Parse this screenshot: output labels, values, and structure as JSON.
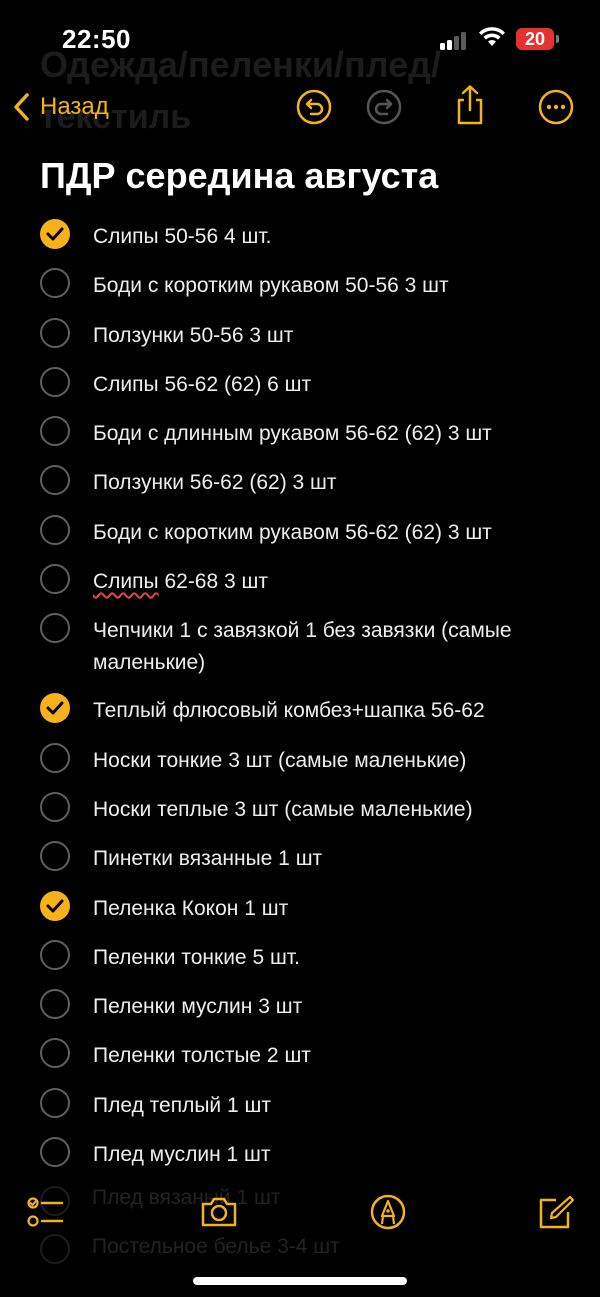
{
  "status_bar": {
    "time": "22:50",
    "battery_level": "20"
  },
  "background_ghost": {
    "line0": "",
    "line1": "Одежда/пеленки/плед/",
    "line2": "текстиль"
  },
  "nav": {
    "back_label": "Назад"
  },
  "note": {
    "title": "ПДР середина августа"
  },
  "checklist": [
    {
      "text": "Слипы 50-56 4 шт.",
      "checked": true
    },
    {
      "text": "Боди с коротким рукавом 50-56 3 шт",
      "checked": false
    },
    {
      "text": "Ползунки 50-56 3 шт",
      "checked": false
    },
    {
      "text": "Слипы 56-62 (62) 6 шт",
      "checked": false
    },
    {
      "text": "Боди с длинным рукавом 56-62 (62) 3 шт",
      "checked": false
    },
    {
      "text": "Ползунки 56-62 (62) 3 шт",
      "checked": false
    },
    {
      "text": "Боди с коротким рукавом 56-62 (62) 3 шт",
      "checked": false
    },
    {
      "text": "Слипы 62-68 3 шт",
      "checked": false
    },
    {
      "text": "Чепчики 1 с завязкой 1 без завязки (самые маленькие)",
      "checked": false
    },
    {
      "text": "Теплый флюсовый комбез+шапка 56-62",
      "checked": true
    },
    {
      "text": "Носки тонкие 3 шт (самые маленькие)",
      "checked": false
    },
    {
      "text": "Носки теплые 3 шт (самые маленькие)",
      "checked": false
    },
    {
      "text": "Пинетки вязанные 1 шт",
      "checked": false
    },
    {
      "text": "Пеленка Кокон 1 шт",
      "checked": true
    },
    {
      "text": "Пеленки тонкие 5 шт.",
      "checked": false
    },
    {
      "text": "Пеленки муслин 3 шт",
      "checked": false
    },
    {
      "text": "Пеленки толстые 2 шт",
      "checked": false
    },
    {
      "text": "Плед теплый 1 шт",
      "checked": false
    },
    {
      "text": "Плед муслин 1 шт",
      "checked": false
    }
  ],
  "ghost_below": {
    "line1": "Плед вязаный 1 шт",
    "line2": "Постельное белье 3-4 шт"
  },
  "icons": {
    "back": "chevron-left-icon",
    "undo": "undo-icon",
    "redo": "redo-icon",
    "share": "share-icon",
    "more": "more-icon",
    "checklist": "checklist-icon",
    "camera": "camera-icon",
    "markup": "markup-pen-icon",
    "compose": "compose-icon"
  },
  "colors": {
    "accent": "#f5b21c",
    "background": "#000000",
    "text": "#eeeeee",
    "unchecked_border": "#5f5f5f",
    "battery_low": "#e5322f"
  }
}
